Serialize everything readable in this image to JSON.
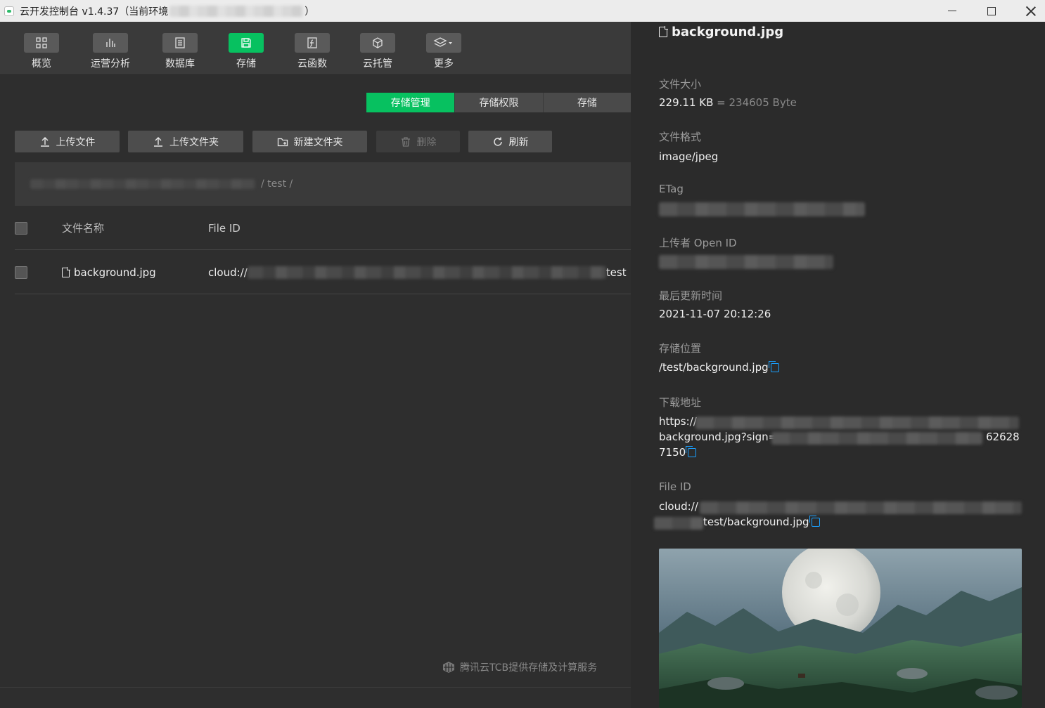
{
  "window": {
    "title_prefix": "云开发控制台 v1.4.37（当前环境",
    "title_suffix": "）"
  },
  "toolbar": {
    "items": [
      {
        "label": "概览",
        "icon": "overview-grid-icon"
      },
      {
        "label": "运营分析",
        "icon": "bar-chart-icon"
      },
      {
        "label": "数据库",
        "icon": "database-icon"
      },
      {
        "label": "存储",
        "icon": "storage-save-icon",
        "active": true
      },
      {
        "label": "云函数",
        "icon": "function-icon"
      },
      {
        "label": "云托管",
        "icon": "cube-icon"
      },
      {
        "label": "更多",
        "icon": "layers-dropdown-icon"
      }
    ]
  },
  "tabs": [
    "存储管理",
    "存储权限",
    "存储"
  ],
  "actions": {
    "upload_file": "上传文件",
    "upload_folder": "上传文件夹",
    "new_folder": "新建文件夹",
    "delete": "删除",
    "refresh": "刷新"
  },
  "breadcrumb": {
    "tail": "/ test /"
  },
  "table": {
    "headers": {
      "name": "文件名称",
      "file_id": "File ID"
    },
    "rows": [
      {
        "name": "background.jpg",
        "file_id_prefix": "cloud://",
        "file_id_suffix": "test"
      }
    ]
  },
  "footer": {
    "brand": "腾讯云TCB提供存储及计算服务"
  },
  "panel": {
    "title": "background.jpg",
    "size_label": "文件大小",
    "size_value": "229.11 KB",
    "size_bytes": "= 234605 Byte",
    "format_label": "文件格式",
    "format_value": "image/jpeg",
    "etag_label": "ETag",
    "uploader_label": "上传者 Open ID",
    "updated_label": "最后更新时间",
    "updated_value": "2021-11-07 20:12:26",
    "location_label": "存储位置",
    "location_value": "/test/background.jpg",
    "download_label": "下载地址",
    "download_line1": "https://",
    "download_line2_prefix": "background.jpg?sign=",
    "download_line2_suffix": "62628",
    "download_line3": "7150",
    "fileid_label": "File ID",
    "fileid_line1": "cloud://",
    "fileid_line2": "test/background.jpg"
  },
  "colors": {
    "accent": "#07c160",
    "copy_icon": "#1aa0ff"
  }
}
